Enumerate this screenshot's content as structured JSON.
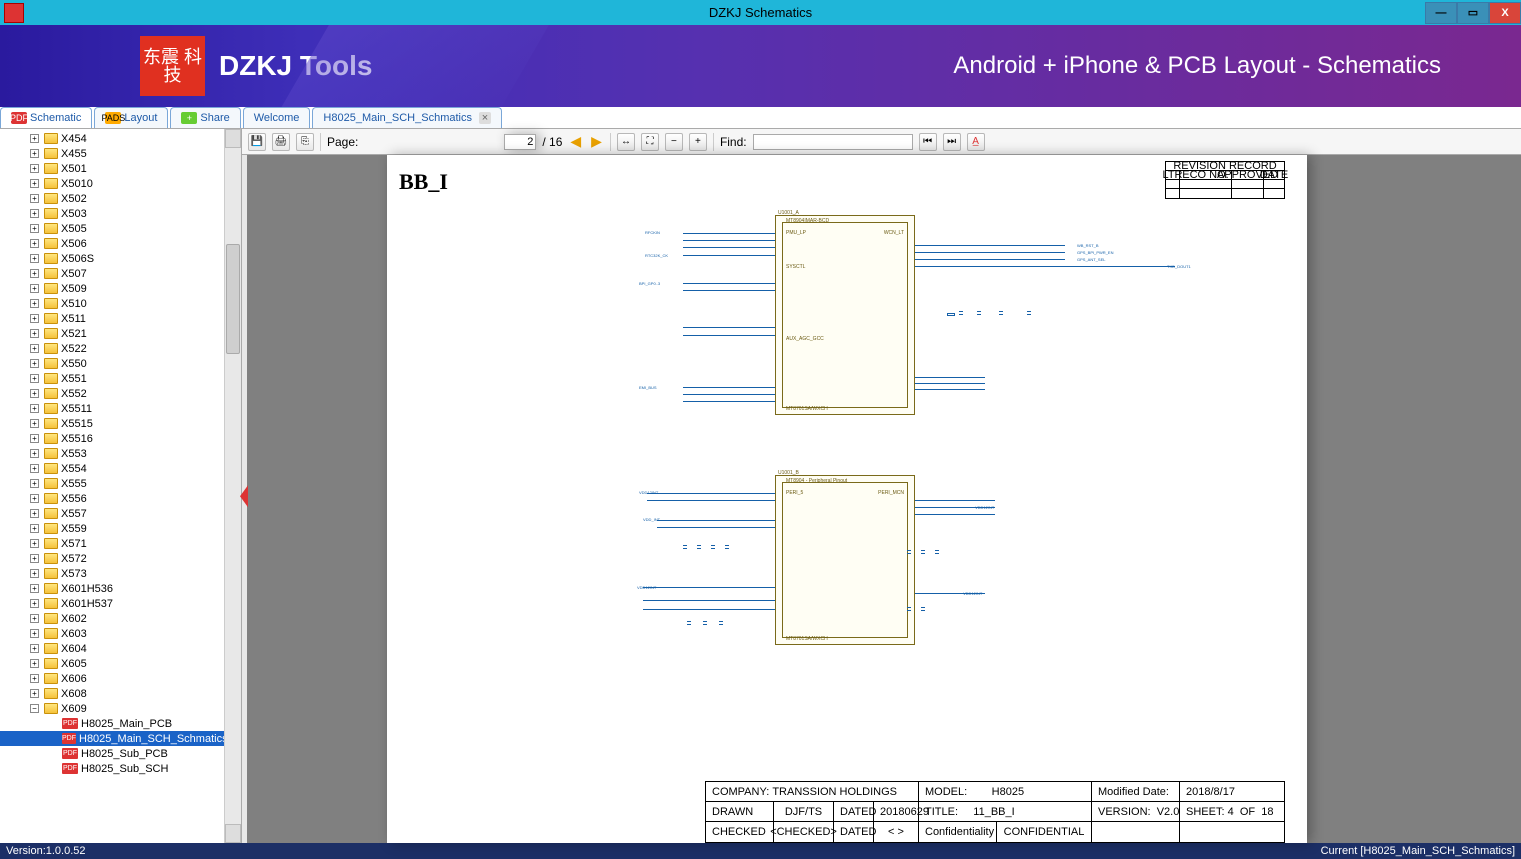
{
  "window": {
    "title": "DZKJ Schematics",
    "min": "—",
    "max": "▭",
    "close": "X"
  },
  "banner": {
    "logo": "东震\n科技",
    "brand": "DZKJ Tools",
    "tagline": "Android + iPhone & PCB Layout - Schematics"
  },
  "tabs": {
    "schematic": "Schematic",
    "layout": "Layout",
    "share": "Share",
    "welcome": "Welcome",
    "doc": "H8025_Main_SCH_Schmatics"
  },
  "tree": {
    "folders": [
      "X454",
      "X455",
      "X501",
      "X5010",
      "X502",
      "X503",
      "X505",
      "X506",
      "X506S",
      "X507",
      "X509",
      "X510",
      "X511",
      "X521",
      "X522",
      "X550",
      "X551",
      "X552",
      "X5511",
      "X5515",
      "X5516",
      "X553",
      "X554",
      "X555",
      "X556",
      "X557",
      "X559",
      "X571",
      "X572",
      "X573",
      "X601H536",
      "X601H537",
      "X602",
      "X603",
      "X604",
      "X605",
      "X606",
      "X608",
      "X609"
    ],
    "x609_children": [
      "H8025_Main_PCB",
      "H8025_Main_SCH_Schmatics",
      "H8025_Sub_PCB",
      "H8025_Sub_SCH"
    ]
  },
  "toolbar": {
    "pageLabel": "Page:",
    "pageCurrent": "2",
    "pageTotal": "/ 16",
    "findLabel": "Find:"
  },
  "sheet": {
    "title": "BB_I"
  },
  "revrecord": {
    "header": "REVISION RECORD",
    "cols": [
      "LTR",
      "ECO NO.",
      "APPROVED",
      "DATE"
    ]
  },
  "titleblock": {
    "company_l": "COMPANY:",
    "company_v": "TRANSSION HOLDINGS",
    "model_l": "MODEL:",
    "model_v": "H8025",
    "moddate_l": "Modified Date:",
    "moddate_v": "2018/8/17",
    "drawn_l": "DRAWN",
    "drawn_v": "DJF/TS",
    "dated1_l": "DATED",
    "dated1_v": "20180629",
    "title_l": "TITLE:",
    "title_v": "11_BB_I",
    "version_l": "VERSION:",
    "version_v": "V2.0",
    "sheet_l": "SHEET:",
    "sheet_v": "4",
    "sheet_of": "OF",
    "sheet_t": "18",
    "checked_l": "CHECKED",
    "checked_v": "<CHECKED>",
    "dated2_l": "DATED",
    "dated2_v": "<  >",
    "conf_l": "Confidentiality",
    "conf_v": "CONFIDENTIAL"
  },
  "status": {
    "version": "Version:1.0.0.52",
    "current": "Current [H8025_Main_SCH_Schmatics]"
  }
}
